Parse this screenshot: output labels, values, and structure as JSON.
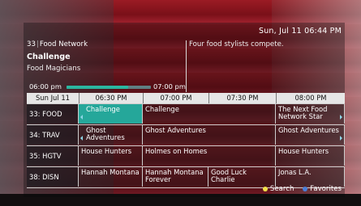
{
  "header": {
    "datetime": "Sun, Jul 11 06:44 PM"
  },
  "current": {
    "channel_number": "33",
    "channel_name": "Food Network",
    "title": "Challenge",
    "episode": "Food Magicians",
    "description": "Four food stylists compete.",
    "start_time": "06:00 pm",
    "end_time": "07:00 pm",
    "progress_fraction": 0.73
  },
  "timebar": {
    "date": "Sun Jul 11",
    "slots": [
      "06:30 PM",
      "07:00 PM",
      "07:30 PM",
      "08:00 PM"
    ]
  },
  "rows": [
    {
      "channel": "33: FOOD",
      "programs": [
        "Challenge",
        "Challenge",
        "The Next Food Network Star"
      ]
    },
    {
      "channel": "34: TRAV",
      "programs": [
        "Ghost Adventures",
        "Ghost Adventures",
        "Ghost Adventures"
      ]
    },
    {
      "channel": "35: HGTV",
      "programs": [
        "House Hunters",
        "Holmes on Homes",
        "House Hunters"
      ]
    },
    {
      "channel": "38: DISN",
      "programs": [
        "Hannah Montana",
        "Hannah Montana Forever",
        "Good Luck Charlie",
        "Jonas L.A."
      ]
    }
  ],
  "legend": {
    "search_label": "Search",
    "favorites_label": "Favorites",
    "search_color": "#f2e14a",
    "favorites_color": "#4a7fd9"
  },
  "colors": {
    "selected": "#25a79a",
    "progress": "#2bb6a0"
  }
}
